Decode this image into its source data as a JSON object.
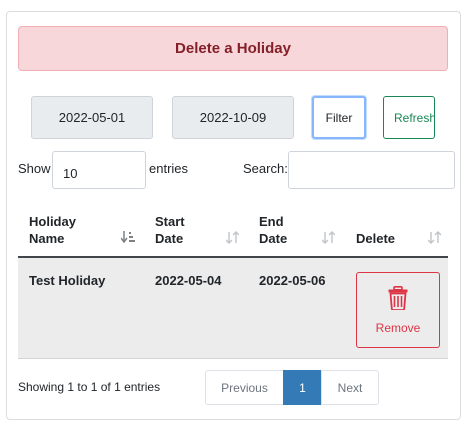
{
  "alert": {
    "title": "Delete a Holiday"
  },
  "filters": {
    "date_from": "2022-05-01",
    "date_to": "2022-10-09",
    "filter_label": "Filter",
    "refresh_label": "Refresh"
  },
  "length": {
    "show_label": "Show",
    "value": "10",
    "entries_label": "entries"
  },
  "search": {
    "label": "Search:",
    "value": ""
  },
  "table": {
    "headers": {
      "holiday_name": [
        "Holiday",
        "Name"
      ],
      "start_date": [
        "Start",
        "Date"
      ],
      "end_date": [
        "End",
        "Date"
      ],
      "delete": "Delete"
    },
    "rows": [
      {
        "holiday_name": "Test Holiday",
        "start_date": "2022-05-04",
        "end_date": "2022-05-06",
        "delete_label": "Remove"
      }
    ]
  },
  "footer": {
    "info": "Showing 1 to 1 of 1 entries",
    "prev": "Previous",
    "page": "1",
    "next": "Next"
  },
  "colors": {
    "alert_bg": "#f8d7da",
    "alert_text": "#842029",
    "danger": "#dc3545",
    "success": "#198754",
    "active_page": "#337ab7"
  },
  "icons": {
    "sort_active": "sort-alpha-down-icon",
    "sort": "sort-icon",
    "delete": "trash-icon"
  }
}
